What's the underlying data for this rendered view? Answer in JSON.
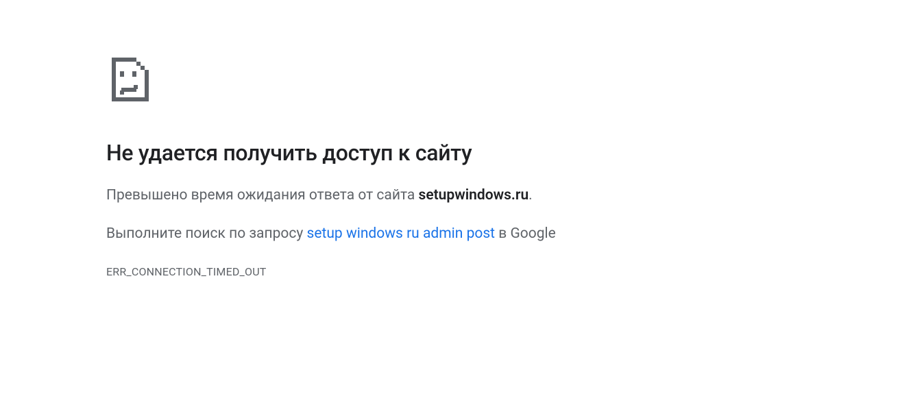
{
  "error": {
    "title": "Не удается получить доступ к сайту",
    "message_prefix": "Превышено время ожидания ответа от сайта ",
    "hostname": "setupwindows.ru",
    "message_suffix": ".",
    "search_prefix": "Выполните поиск по запросу ",
    "search_query": "setup windows ru admin post",
    "search_suffix": " в Google",
    "code": "ERR_CONNECTION_TIMED_OUT"
  },
  "icon_name": "sad-page-icon"
}
